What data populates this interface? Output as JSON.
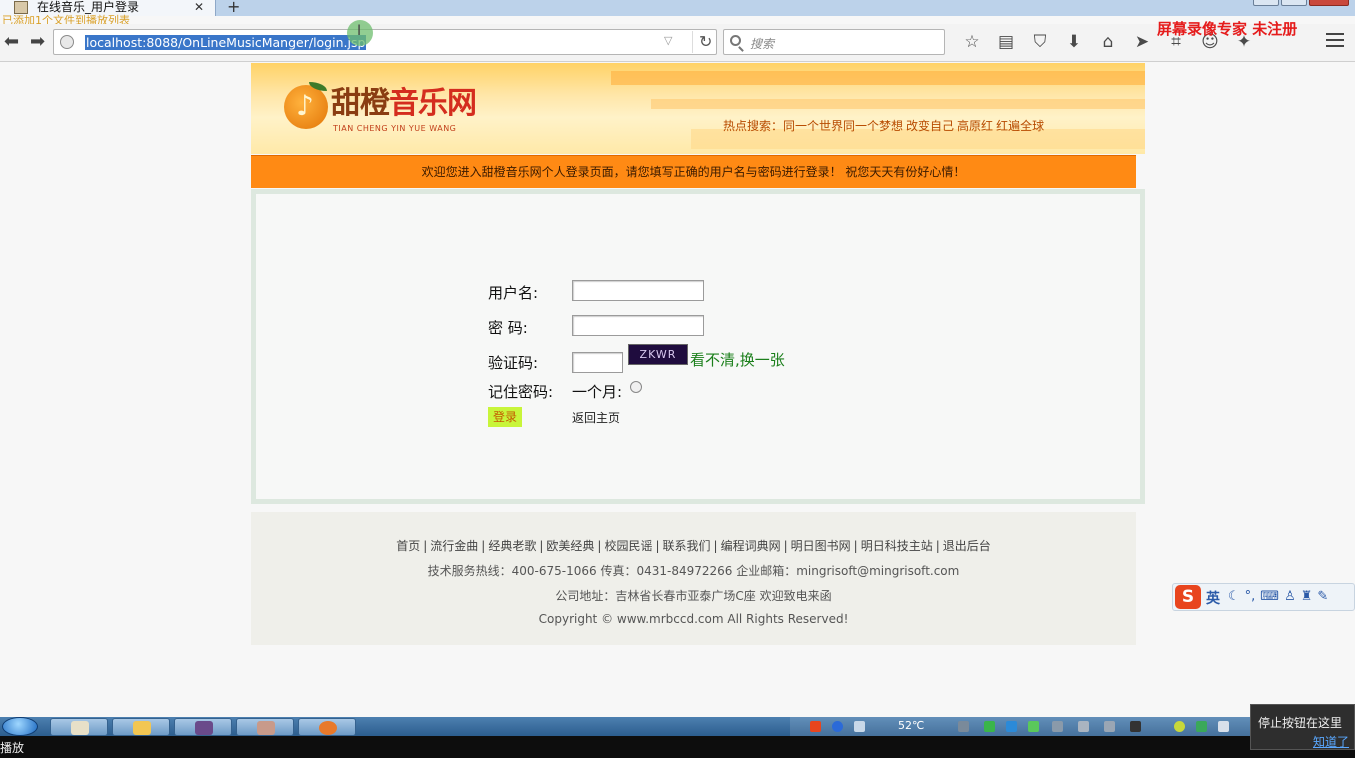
{
  "browser": {
    "tab_title": "在线音乐_用户登录",
    "tab_close": "✕",
    "new_tab": "+",
    "notice": "已添加1个文件到播放列表",
    "url": "localhost:8088/OnLineMusicManger/login.jsp",
    "search_placeholder": "搜索",
    "watermark": "屏幕录像专家  未注册",
    "toolbar_icons": [
      "star-icon",
      "reader-icon",
      "pocket-icon",
      "download-icon",
      "home-icon",
      "send-icon",
      "crop-icon",
      "chat-icon",
      "extension-icon",
      "menu-icon"
    ]
  },
  "header": {
    "logo_text_a": "甜橙",
    "logo_text_b": "音乐网",
    "logo_pinyin": "TIAN CHENG YIN YUE WANG",
    "hot_search_label": "热点搜索：",
    "hot_search_items": [
      "同一个世界同一个梦想",
      "改变自己",
      "高原红",
      "红遍全球"
    ]
  },
  "welcome": "欢迎您进入甜橙音乐网个人登录页面，请您填写正确的用户名与密码进行登录！ 祝您天天有份好心情！",
  "login": {
    "username_label": "用户名:",
    "password_label": "密  码:",
    "captcha_label": "验证码:",
    "captcha_text": "ZKWR",
    "captcha_refresh": "看不清,换一张",
    "remember_label": "记住密码:",
    "remember_option": "一个月:",
    "login_button": "登录",
    "back_link": "返回主页"
  },
  "footer": {
    "links": [
      "首页",
      "流行金曲",
      "经典老歌",
      "欧美经典",
      "校园民谣",
      "联系我们",
      "编程词典网",
      "明日图书网",
      "明日科技主站",
      "退出后台"
    ],
    "hotline": "技术服务热线：400-675-1066 传真：0431-84972266 企业邮箱：mingrisoft@mingrisoft.com",
    "address": "公司地址：吉林省长春市亚泰广场C座 欢迎致电来函",
    "copyright": "Copyright © www.mrbccd.com All Rights Reserved!"
  },
  "ime": {
    "logo": "S",
    "mode": "英"
  },
  "taskbar": {
    "temperature": "52℃",
    "status": "播放"
  },
  "tooltip": {
    "text": "停止按钮在这里",
    "link": "知道了"
  },
  "colors": {
    "welcome_bar": "#ff8a14",
    "login_button": "#c8f53a",
    "refresh_link": "#1b7f1b",
    "watermark": "#e51c1c"
  }
}
